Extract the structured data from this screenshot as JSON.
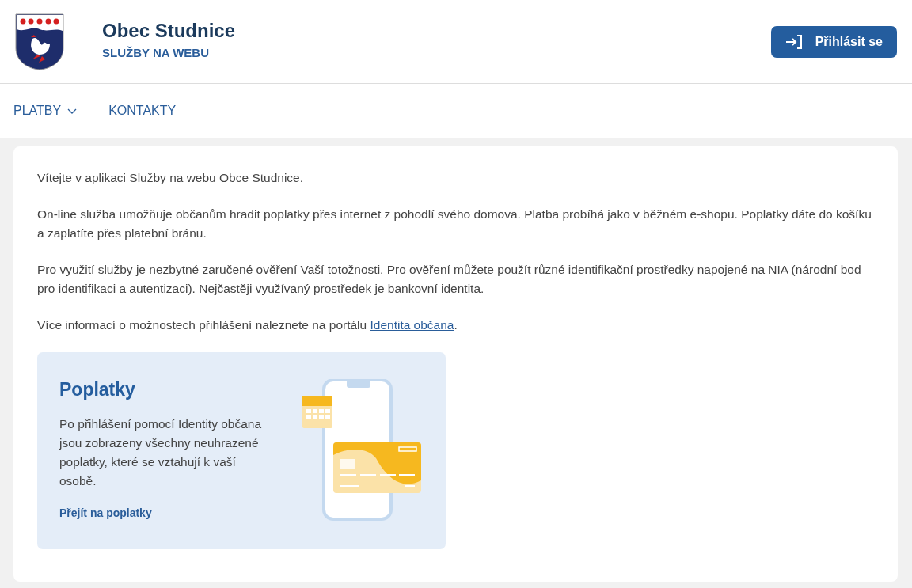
{
  "header": {
    "title": "Obec Studnice",
    "subtitle": "SLUŽBY NA WEBU",
    "login_button": "Přihlásit se"
  },
  "nav": [
    {
      "label": "PLATBY",
      "has_dropdown": true
    },
    {
      "label": "KONTAKTY",
      "has_dropdown": false
    }
  ],
  "intro": {
    "paragraphs": [
      "Vítejte v aplikaci Služby na webu Obce Studnice.",
      "On-line služba umožňuje občanům hradit poplatky přes internet z pohodlí svého domova. Platba probíhá jako v běžném e-shopu. Poplatky dáte do košíku a zaplatíte přes platební bránu.",
      "Pro využití služby je nezbytné zaručené ověření Vaší totožnosti. Pro ověření můžete použít různé identifikační prostředky napojené na NIA (národní bod pro identifikaci a autentizaci). Nejčastěji využívaný prostředek je bankovní identita."
    ],
    "info": {
      "before": "Více informací o možnostech přihlášení naleznete na portálu ",
      "link": "Identita občana",
      "after": "."
    }
  },
  "card": {
    "title": "Poplatky",
    "text": "Po přihlášení pomocí Identity občana jsou zobrazeny všechny neuhrazené poplatky, které se vztahují k vaší osobě.",
    "link": "Přejít na poplatky"
  }
}
